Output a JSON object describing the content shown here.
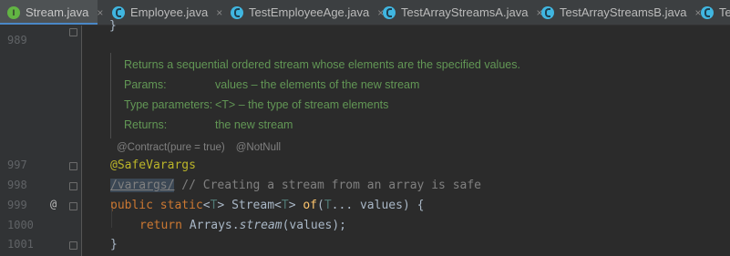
{
  "tabs": [
    {
      "label": "Stream.java",
      "icon": "interface-icon",
      "active": true
    },
    {
      "label": "Employee.java",
      "icon": "class-icon",
      "active": false
    },
    {
      "label": "TestEmployeeAge.java",
      "icon": "class-icon",
      "active": false
    },
    {
      "label": "TestArrayStreamsA.java",
      "icon": "class-icon",
      "active": false
    },
    {
      "label": "TestArrayStreamsB.java",
      "icon": "class-icon",
      "active": false
    },
    {
      "label": "Tes",
      "icon": "class-icon",
      "active": false
    }
  ],
  "tab_close": "×",
  "interface_badge": "I",
  "gutter": {
    "line_numbers": [
      "989",
      "997",
      "998",
      "999",
      "1000",
      "1001"
    ],
    "override_marker": "@"
  },
  "editor": {
    "top_brace": "}",
    "doc": {
      "summary": "Returns a sequential ordered stream whose elements are the specified values.",
      "params_key": "Params:",
      "params_value": "values – the elements of the new stream",
      "type_params_key": "Type parameters:",
      "type_params_value": "<T> – the type of stream elements",
      "returns_key": "Returns:",
      "returns_value": "the new stream"
    },
    "inferred_annotations": [
      "@Contract(pure = true)",
      "@NotNull"
    ],
    "code": {
      "l997_annotation": "@SafeVarargs",
      "l998_tag": "/varargs/",
      "l998_comment": " // Creating a stream from an array is safe",
      "l999_kw_public": "public",
      "l999_kw_static": "static",
      "l999_tparam_open": "<",
      "l999_tparam_T": "T",
      "l999_tparam_close": "> Stream<",
      "l999_T2": "T",
      "l999_close2": "> ",
      "l999_method": "of",
      "l999_paren": "(",
      "l999_T3": "T",
      "l999_rest": "... values) {",
      "l1000_kw_return": "return",
      "l1000_class": " Arrays.",
      "l1000_method": "stream",
      "l1000_rest": "(values);",
      "l1001_brace": "}"
    }
  }
}
